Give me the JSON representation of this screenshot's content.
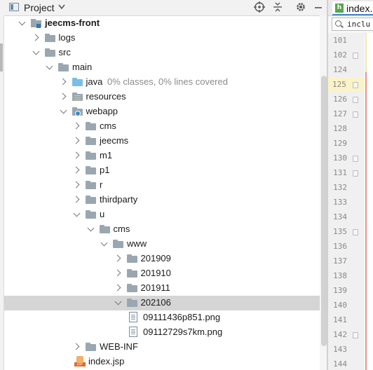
{
  "project_panel": {
    "title": "Project",
    "toolbar_icons": [
      "target-icon",
      "collapse-all-icon",
      "gear-icon",
      "minimize-icon"
    ]
  },
  "tree": [
    {
      "label": "jeecms-front",
      "type": "module",
      "state": "expanded",
      "bold": true
    },
    {
      "label": "logs",
      "type": "folder",
      "state": "collapsed"
    },
    {
      "label": "src",
      "type": "folder",
      "state": "expanded"
    },
    {
      "label": "main",
      "type": "folder",
      "state": "expanded"
    },
    {
      "label": "java",
      "type": "source-folder",
      "state": "collapsed",
      "note": "0% classes, 0% lines covered"
    },
    {
      "label": "resources",
      "type": "resources-folder",
      "state": "collapsed"
    },
    {
      "label": "webapp",
      "type": "web-folder",
      "state": "expanded"
    },
    {
      "label": "cms",
      "type": "folder",
      "state": "collapsed"
    },
    {
      "label": "jeecms",
      "type": "folder",
      "state": "collapsed"
    },
    {
      "label": "m1",
      "type": "folder",
      "state": "collapsed"
    },
    {
      "label": "p1",
      "type": "folder",
      "state": "collapsed"
    },
    {
      "label": "r",
      "type": "folder",
      "state": "collapsed"
    },
    {
      "label": "thirdparty",
      "type": "folder",
      "state": "collapsed"
    },
    {
      "label": "u",
      "type": "folder",
      "state": "expanded"
    },
    {
      "label": "cms",
      "type": "folder",
      "state": "expanded"
    },
    {
      "label": "www",
      "type": "folder",
      "state": "expanded"
    },
    {
      "label": "201909",
      "type": "folder",
      "state": "collapsed"
    },
    {
      "label": "201910",
      "type": "folder",
      "state": "collapsed"
    },
    {
      "label": "201911",
      "type": "folder",
      "state": "collapsed"
    },
    {
      "label": "202106",
      "type": "folder",
      "state": "expanded",
      "selected": true
    },
    {
      "label": "09111436p851.png",
      "type": "image-file"
    },
    {
      "label": "09112729s7km.png",
      "type": "image-file"
    },
    {
      "label": "WEB-INF",
      "type": "folder",
      "state": "collapsed"
    },
    {
      "label": "index.jsp",
      "type": "jsp-file"
    }
  ],
  "editor": {
    "tab_label": "index.",
    "tab_icon": "h",
    "search_text": "inclu",
    "line_numbers": [
      "101",
      "102",
      "124",
      "125",
      "126",
      "127",
      "128",
      "129",
      "130",
      "131",
      "132",
      "133",
      "134",
      "135",
      "136",
      "137",
      "138",
      "139",
      "140",
      "141",
      "142",
      "143",
      "144"
    ],
    "current_line": "125",
    "colors": {
      "current_line_bg": "#fbf3c8",
      "changed_marker": "#ef8c8c",
      "selection_bg": "#d5d5d5"
    }
  }
}
